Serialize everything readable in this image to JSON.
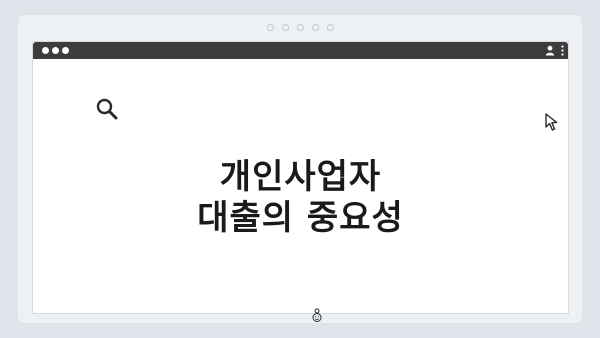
{
  "window": {
    "traffic_lights": 3,
    "toolbar_icons": [
      "user-icon",
      "more-vert-icon"
    ]
  },
  "content": {
    "headline_line1": "개인사업자",
    "headline_line2": "대출의 중요성",
    "icons": [
      "search-icon",
      "cursor-icon",
      "smile-face-icon"
    ]
  },
  "colors": {
    "titlebar": "#3c3c3c",
    "background": "#dfe4ea",
    "text": "#1a1a1a"
  }
}
